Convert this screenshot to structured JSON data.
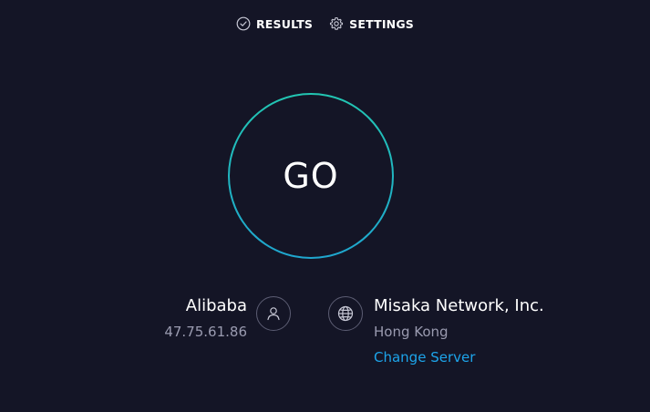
{
  "nav": {
    "results": {
      "label": "RESULTS",
      "icon": "check-circle-icon"
    },
    "settings": {
      "label": "SETTINGS",
      "icon": "gear-icon"
    }
  },
  "go_button": {
    "label": "GO",
    "ring_colors": [
      "#22c6b2",
      "#1fa6cf"
    ]
  },
  "host": {
    "provider": "Alibaba",
    "ip": "47.75.61.86",
    "icon": "user-icon"
  },
  "server": {
    "name": "Misaka Network, Inc.",
    "location": "Hong Kong",
    "change_label": "Change Server",
    "icon": "globe-icon"
  },
  "colors": {
    "background": "#141526",
    "accent_link": "#1da4ea",
    "muted_text": "#9a9bb0"
  }
}
